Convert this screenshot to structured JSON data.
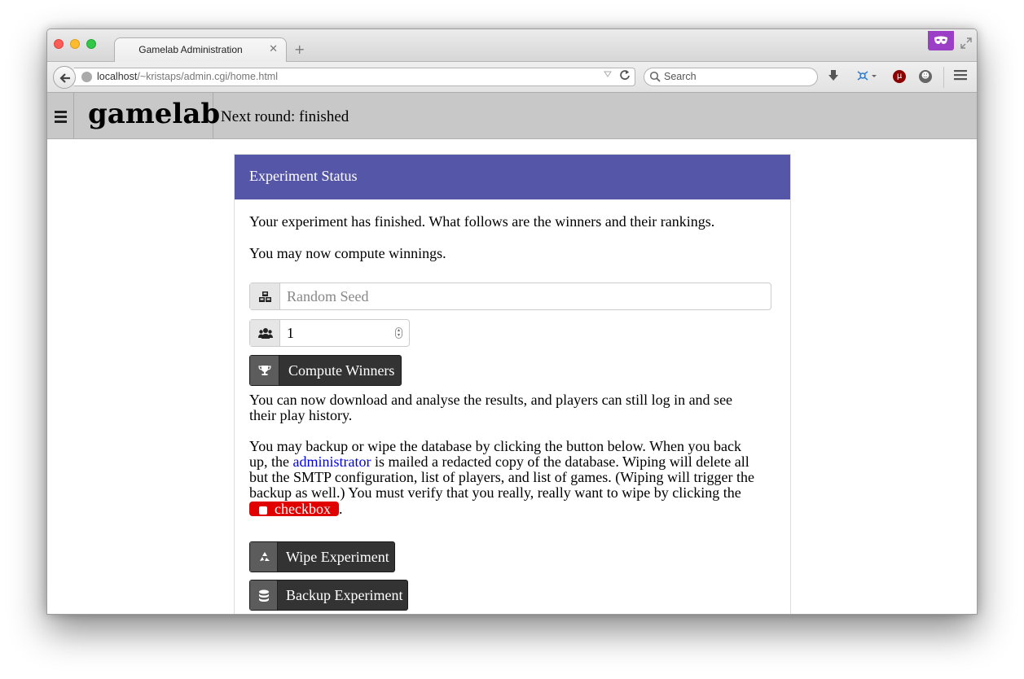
{
  "browser": {
    "tab_title": "Gamelab Administration",
    "tab_close": "✕",
    "new_tab": "+",
    "url_host": "localhost",
    "url_path": "/~kristaps/admin.cgi/home.html",
    "search_placeholder": "Search"
  },
  "header": {
    "brand": "gamelab",
    "next_round": "Next round: finished"
  },
  "panel": {
    "title": "Experiment Status",
    "intro": "Your experiment has finished. What follows are the winners and their rankings.",
    "compute_note": "You may now compute winnings.",
    "seed_placeholder": "Random Seed",
    "winners_count": "1",
    "compute_button": "Compute Winners",
    "download_note_line1": "You can now download and analyse the results, and players can still log in and see",
    "download_note_line2": "their play history.",
    "wipe_note_line1": "You may backup or wipe the database by clicking the button below. When you back",
    "wipe_note_line2_pre": "up, the ",
    "wipe_note_link": "administrator",
    "wipe_note_line2_post": " is mailed a redacted copy of the database. Wiping will delete all",
    "wipe_note_line3": "but the SMTP configuration, list of players, and list of games. (Wiping will trigger the",
    "wipe_note_line4": "backup as well.) You must verify that you really, really want to wipe by clicking the",
    "checkbox_label": "checkbox",
    "checkbox_after": ".",
    "wipe_button": "Wipe Experiment",
    "backup_button": "Backup Experiment"
  },
  "colors": {
    "panel_header": "#5656a8",
    "checkbox_pill": "#e00000",
    "button": "#333333",
    "link": "#0000ee"
  }
}
